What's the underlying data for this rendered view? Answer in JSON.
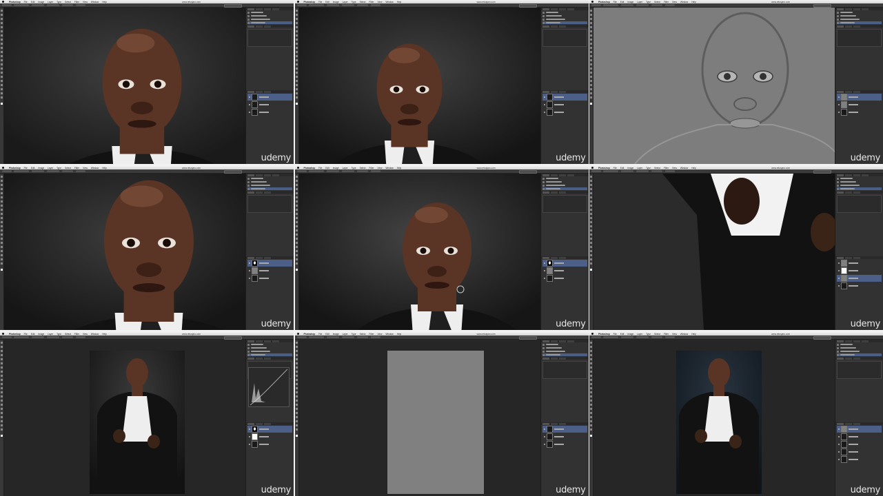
{
  "app": {
    "name": "Photoshop",
    "menus": [
      "File",
      "Edit",
      "Image",
      "Layer",
      "Type",
      "Select",
      "Filter",
      "View",
      "Window",
      "Help"
    ],
    "url": "www.retusjaro.com",
    "brand_watermark": "udemy"
  },
  "colors": {
    "menubar": "#e3e3e3",
    "toolbar": "#383838",
    "canvas": "#282828",
    "panel": "#323232",
    "selection_highlight": "#4b5f88",
    "skin": "#5a3424",
    "suit": "#121212",
    "shirt": "#eeeeee",
    "frequency_gray": "#808080"
  },
  "frames": [
    {
      "id": "top-left",
      "content": "portrait-closeup",
      "selected_layer": 0
    },
    {
      "id": "top-middle",
      "content": "portrait-medium",
      "selected_layer": 0
    },
    {
      "id": "top-right",
      "content": "high-pass-gray",
      "selected_layer": 0
    },
    {
      "id": "mid-left",
      "content": "portrait-face-crop",
      "selected_layer": 0
    },
    {
      "id": "mid-middle",
      "content": "portrait-with-brush",
      "selected_layer": 0
    },
    {
      "id": "mid-right",
      "content": "suit-opening",
      "selected_layer": 2
    },
    {
      "id": "bottom-left",
      "content": "full-portrait-curves",
      "selected_layer": 0
    },
    {
      "id": "bottom-middle",
      "content": "gray-canvas",
      "selected_layer": 0
    },
    {
      "id": "bottom-right",
      "content": "full-portrait-graded",
      "selected_layer": 0
    }
  ],
  "icons": [
    "apple-icon",
    "eye-icon",
    "brush-cursor-icon",
    "layer-thumbnail-icon",
    "tool-icon",
    "color-swatch-icon"
  ]
}
